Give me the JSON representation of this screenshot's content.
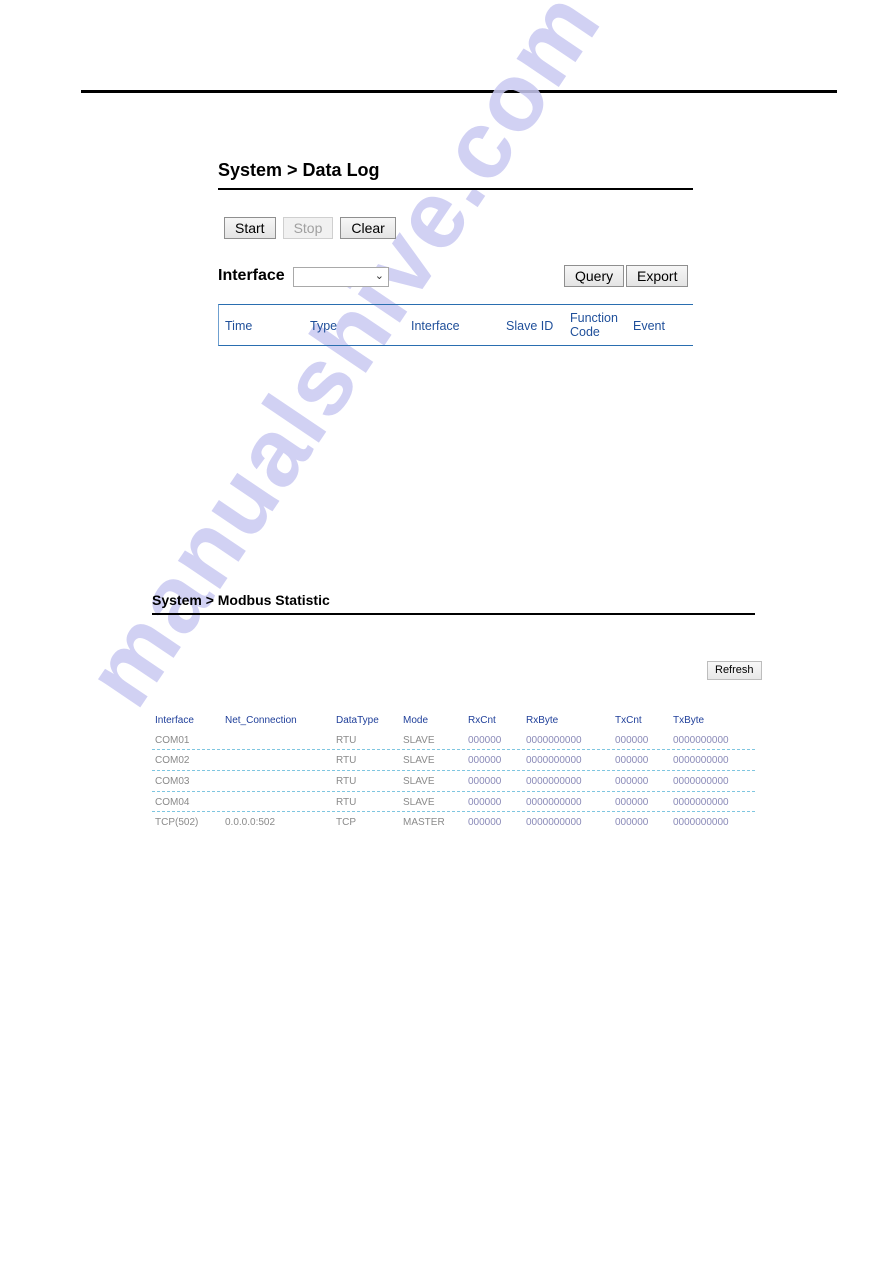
{
  "watermark": "manualshive.com",
  "data_log": {
    "title": "System > Data Log",
    "buttons": {
      "start": "Start",
      "stop": "Stop",
      "clear": "Clear",
      "query": "Query",
      "export": "Export"
    },
    "stop_disabled": true,
    "filter": {
      "label": "Interface",
      "selected": ""
    },
    "table_headers": [
      "Time",
      "Type",
      "Interface",
      "Slave ID",
      "Function Code",
      "Event"
    ],
    "rows": []
  },
  "modbus_statistic": {
    "title": "System > Modbus Statistic",
    "refresh_label": "Refresh",
    "headers": [
      "Interface",
      "Net_Connection",
      "DataType",
      "Mode",
      "RxCnt",
      "RxByte",
      "TxCnt",
      "TxByte"
    ],
    "rows": [
      [
        "COM01",
        "",
        "RTU",
        "SLAVE",
        "000000",
        "0000000000",
        "000000",
        "0000000000"
      ],
      [
        "COM02",
        "",
        "RTU",
        "SLAVE",
        "000000",
        "0000000000",
        "000000",
        "0000000000"
      ],
      [
        "COM03",
        "",
        "RTU",
        "SLAVE",
        "000000",
        "0000000000",
        "000000",
        "0000000000"
      ],
      [
        "COM04",
        "",
        "RTU",
        "SLAVE",
        "000000",
        "0000000000",
        "000000",
        "0000000000"
      ],
      [
        "TCP(502)",
        "0.0.0.0:502",
        "TCP",
        "MASTER",
        "000000",
        "0000000000",
        "000000",
        "0000000000"
      ]
    ]
  }
}
